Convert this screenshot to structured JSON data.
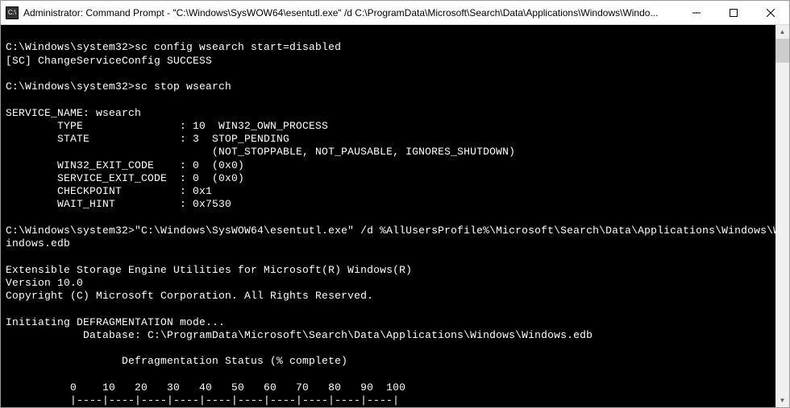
{
  "titlebar": {
    "icon_label": "C:\\",
    "title": "Administrator: Command Prompt - \"C:\\Windows\\SysWOW64\\esentutl.exe\"  /d C:\\ProgramData\\Microsoft\\Search\\Data\\Applications\\Windows\\Windo..."
  },
  "terminal": {
    "content": "\nC:\\Windows\\system32>sc config wsearch start=disabled\n[SC] ChangeServiceConfig SUCCESS\n\nC:\\Windows\\system32>sc stop wsearch\n\nSERVICE_NAME: wsearch\n        TYPE               : 10  WIN32_OWN_PROCESS\n        STATE              : 3  STOP_PENDING\n                                (NOT_STOPPABLE, NOT_PAUSABLE, IGNORES_SHUTDOWN)\n        WIN32_EXIT_CODE    : 0  (0x0)\n        SERVICE_EXIT_CODE  : 0  (0x0)\n        CHECKPOINT         : 0x1\n        WAIT_HINT          : 0x7530\n\nC:\\Windows\\system32>\"C:\\Windows\\SysWOW64\\esentutl.exe\" /d %AllUsersProfile%\\Microsoft\\Search\\Data\\Applications\\Windows\\W\nindows.edb\n\nExtensible Storage Engine Utilities for Microsoft(R) Windows(R)\nVersion 10.0\nCopyright (C) Microsoft Corporation. All Rights Reserved.\n\nInitiating DEFRAGMENTATION mode...\n            Database: C:\\ProgramData\\Microsoft\\Search\\Data\\Applications\\Windows\\Windows.edb\n\n                  Defragmentation Status (% complete)\n\n          0    10   20   30   40   50   60   70   80   90  100\n          |----|----|----|----|----|----|----|----|----|----|\n          ..............................."
  },
  "scrollbar": {
    "up_glyph": "▲",
    "down_glyph": "▼"
  }
}
